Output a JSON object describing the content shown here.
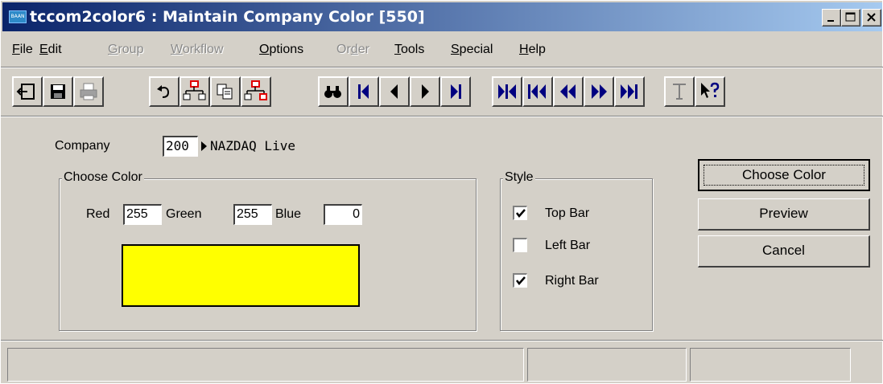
{
  "window": {
    "title": "tccom2color6 : Maintain Company Color [550]",
    "app_icon_text": "BAAN"
  },
  "menu": [
    {
      "pre": "",
      "ul": "F",
      "post": "ile",
      "enabled": true
    },
    {
      "pre": "",
      "ul": "E",
      "post": "dit",
      "enabled": true
    },
    {
      "pre": "",
      "ul": "G",
      "post": "roup",
      "enabled": false
    },
    {
      "pre": "",
      "ul": "W",
      "post": "orkflow",
      "enabled": false
    },
    {
      "pre": "",
      "ul": "O",
      "post": "ptions",
      "enabled": true
    },
    {
      "pre": "Or",
      "ul": "d",
      "post": "er",
      "enabled": false
    },
    {
      "pre": "",
      "ul": "T",
      "post": "ools",
      "enabled": true
    },
    {
      "pre": "",
      "ul": "S",
      "post": "pecial",
      "enabled": true
    },
    {
      "pre": "",
      "ul": "H",
      "post": "elp",
      "enabled": true
    }
  ],
  "toolbar": {
    "icons": [
      "exit-icon",
      "save-icon",
      "print-icon",
      "undo-icon",
      "insert-record-icon",
      "copy-icon",
      "duplicate-record-icon",
      "find-icon",
      "first-record-icon",
      "previous-record-icon",
      "next-record-icon",
      "last-record-icon",
      "first-set-icon",
      "previous-set-icon",
      "rewind-icon",
      "fast-forward-icon",
      "last-set-icon",
      "text-icon",
      "help-pointer-icon"
    ]
  },
  "form": {
    "company_label": "Company",
    "company_value": "200",
    "company_name": "NAZDAQ Live",
    "choose_color_group": "Choose Color",
    "red_label": "Red",
    "red_value": "255",
    "green_label": "Green",
    "green_value": "255",
    "blue_label": "Blue",
    "blue_value": "0",
    "preview_color": "#ffff00",
    "style_group": "Style",
    "top_bar_label": "Top Bar",
    "top_bar_checked": true,
    "left_bar_label": "Left Bar",
    "left_bar_checked": false,
    "right_bar_label": "Right Bar",
    "right_bar_checked": true
  },
  "buttons": {
    "choose_color": "Choose Color",
    "preview": "Preview",
    "cancel": "Cancel"
  },
  "colors": {
    "title_start": "#0a246a",
    "title_end": "#a6caf0",
    "face": "#d4d0c8"
  }
}
